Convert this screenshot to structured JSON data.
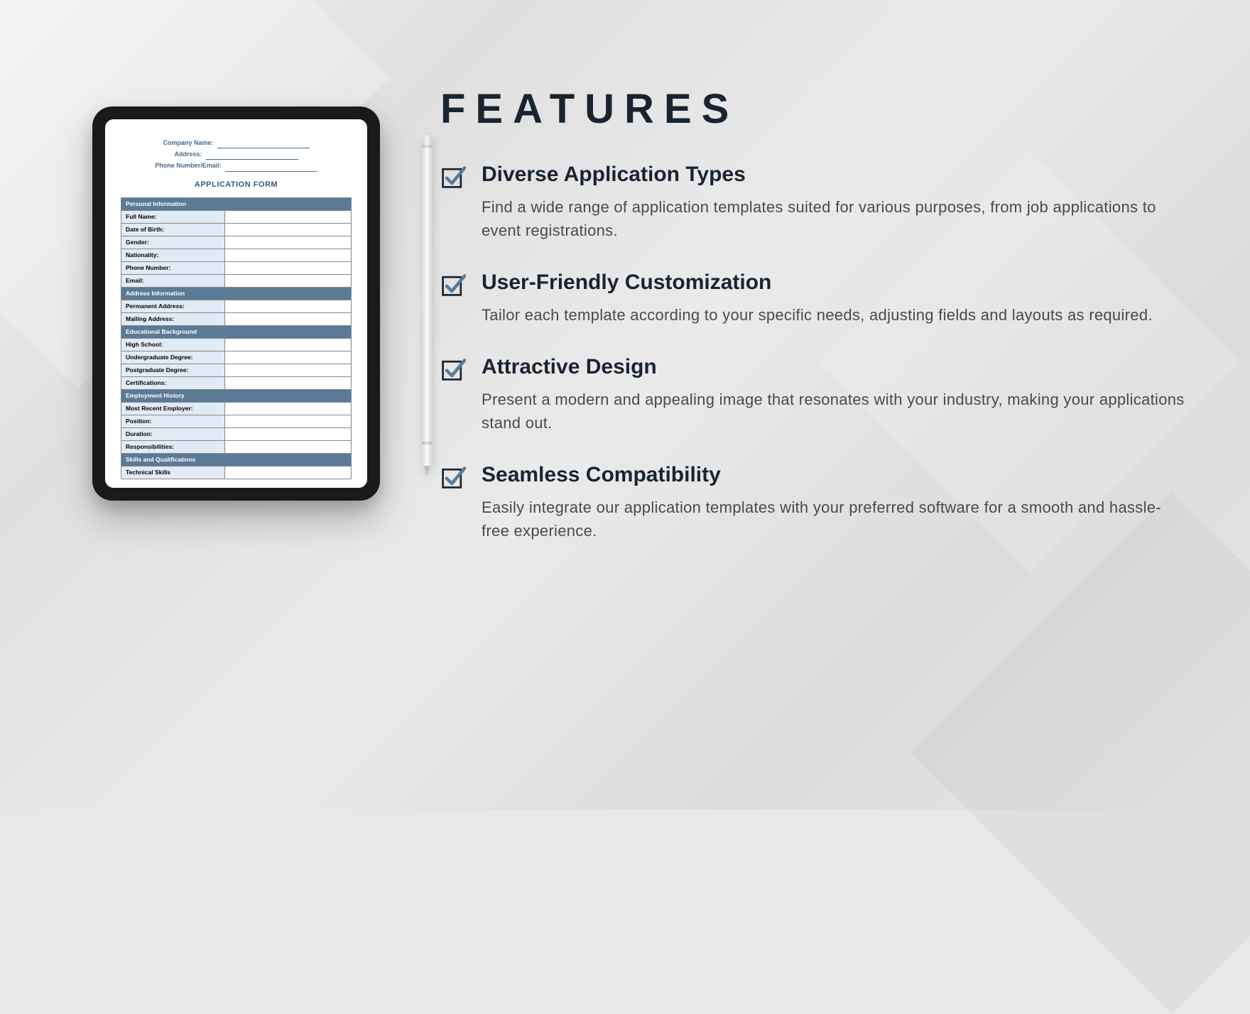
{
  "heading": "FEATURES",
  "features": [
    {
      "title": "Diverse Application Types",
      "desc": "Find a wide range of application templates suited for various purposes, from job applications to event registrations."
    },
    {
      "title": "User-Friendly Customization",
      "desc": "Tailor each template according to your specific needs, adjusting fields and layouts as required."
    },
    {
      "title": "Attractive Design",
      "desc": "Present a modern and appealing image that resonates with your industry, making your applications stand out."
    },
    {
      "title": "Seamless Compatibility",
      "desc": "Easily integrate our application templates with your preferred software for a smooth and hassle-free experience."
    }
  ],
  "form": {
    "header": {
      "company_label": "Company Name:",
      "address_label": "Address:",
      "phone_label": "Phone Number/Email:"
    },
    "title": "APPLICATION FORM",
    "sections": [
      {
        "header": "Personal Information",
        "fields": [
          "Full Name:",
          "Date of Birth:",
          "Gender:",
          "Nationality:",
          "Phone Number:",
          "Email:"
        ]
      },
      {
        "header": "Address Information",
        "fields": [
          "Permanent Address:",
          "Mailing Address:"
        ]
      },
      {
        "header": "Educational Background",
        "fields": [
          "High School:",
          "Undergraduate Degree:",
          "Postgraduate Degree:",
          "Certifications:"
        ]
      },
      {
        "header": "Employment History",
        "fields": [
          "Most Recent Employer:",
          "Position:",
          "Duration:",
          "Responsibilities:"
        ]
      },
      {
        "header": "Skills and Qualifications",
        "fields": [
          "Technical Skills"
        ]
      }
    ]
  }
}
